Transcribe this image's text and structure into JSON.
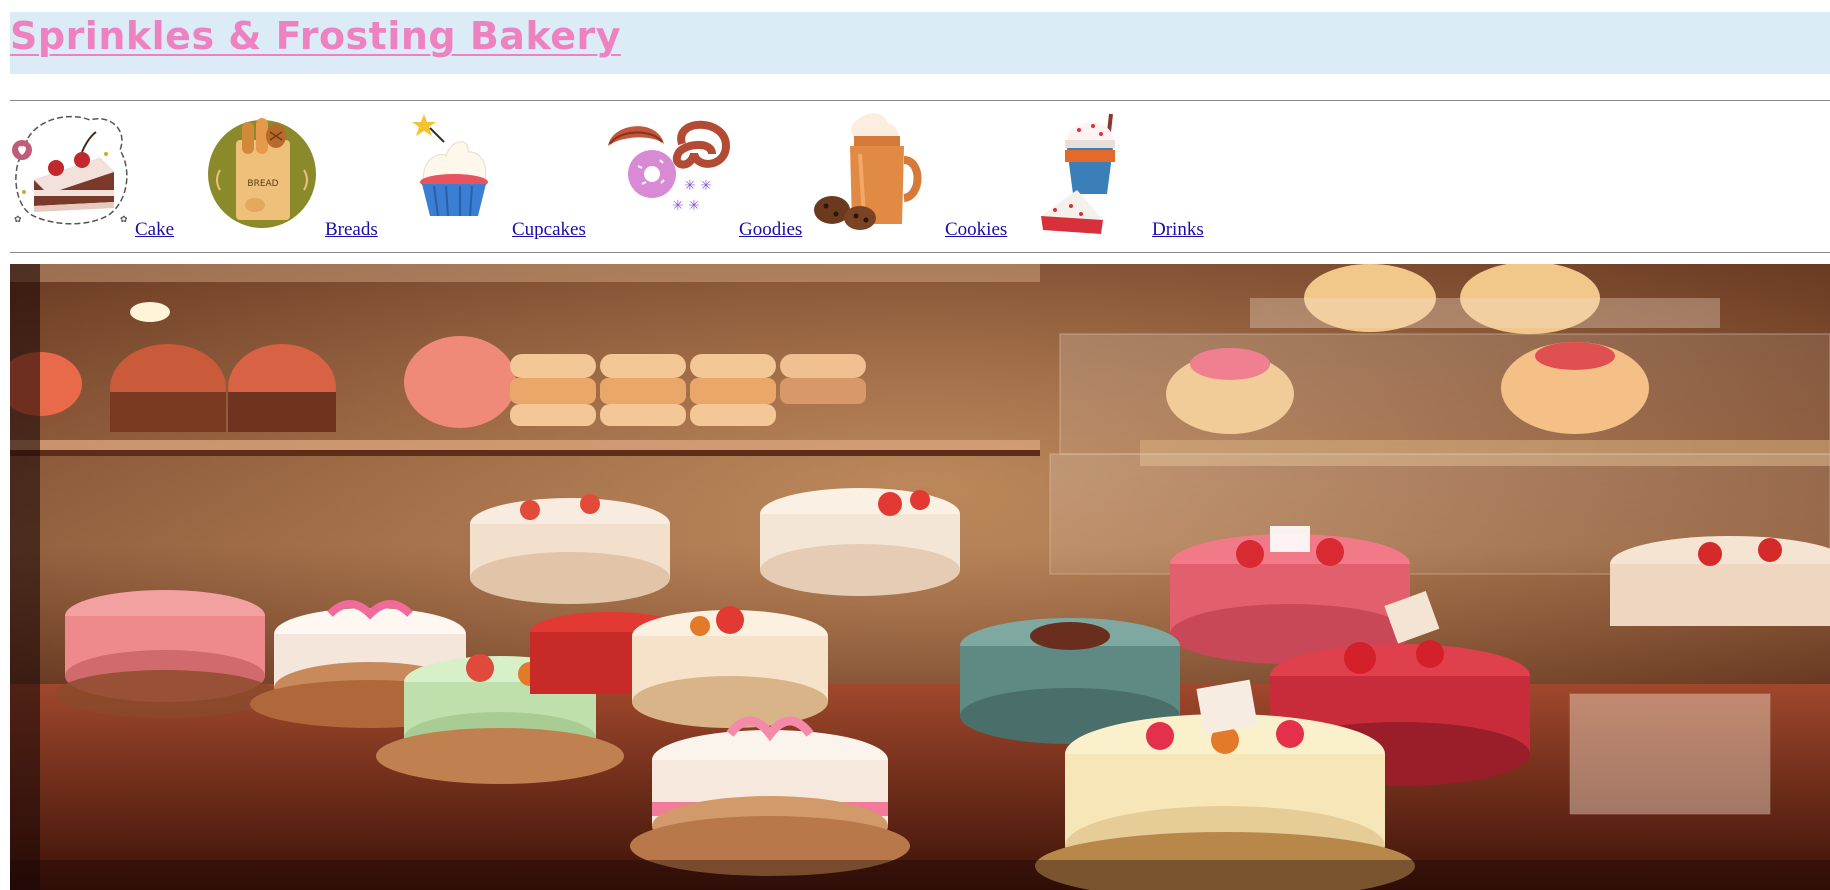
{
  "header": {
    "title": "Sprinkles & Frosting Bakery",
    "title_color": "#ee82c0",
    "banner_color": "#dbecf7"
  },
  "nav": {
    "items": [
      {
        "label": "Cake",
        "icon": "cake-slice-icon"
      },
      {
        "label": "Breads",
        "icon": "bread-bag-icon"
      },
      {
        "label": "Cupcakes",
        "icon": "cupcake-icon"
      },
      {
        "label": "Goodies",
        "icon": "donut-pretzel-icon"
      },
      {
        "label": "Cookies",
        "icon": "milkshake-cookies-icon"
      },
      {
        "label": "Drinks",
        "icon": "drink-pie-icon"
      }
    ],
    "link_color": "#1a0dab"
  },
  "hero": {
    "image": "bakery-display-case-photo"
  }
}
